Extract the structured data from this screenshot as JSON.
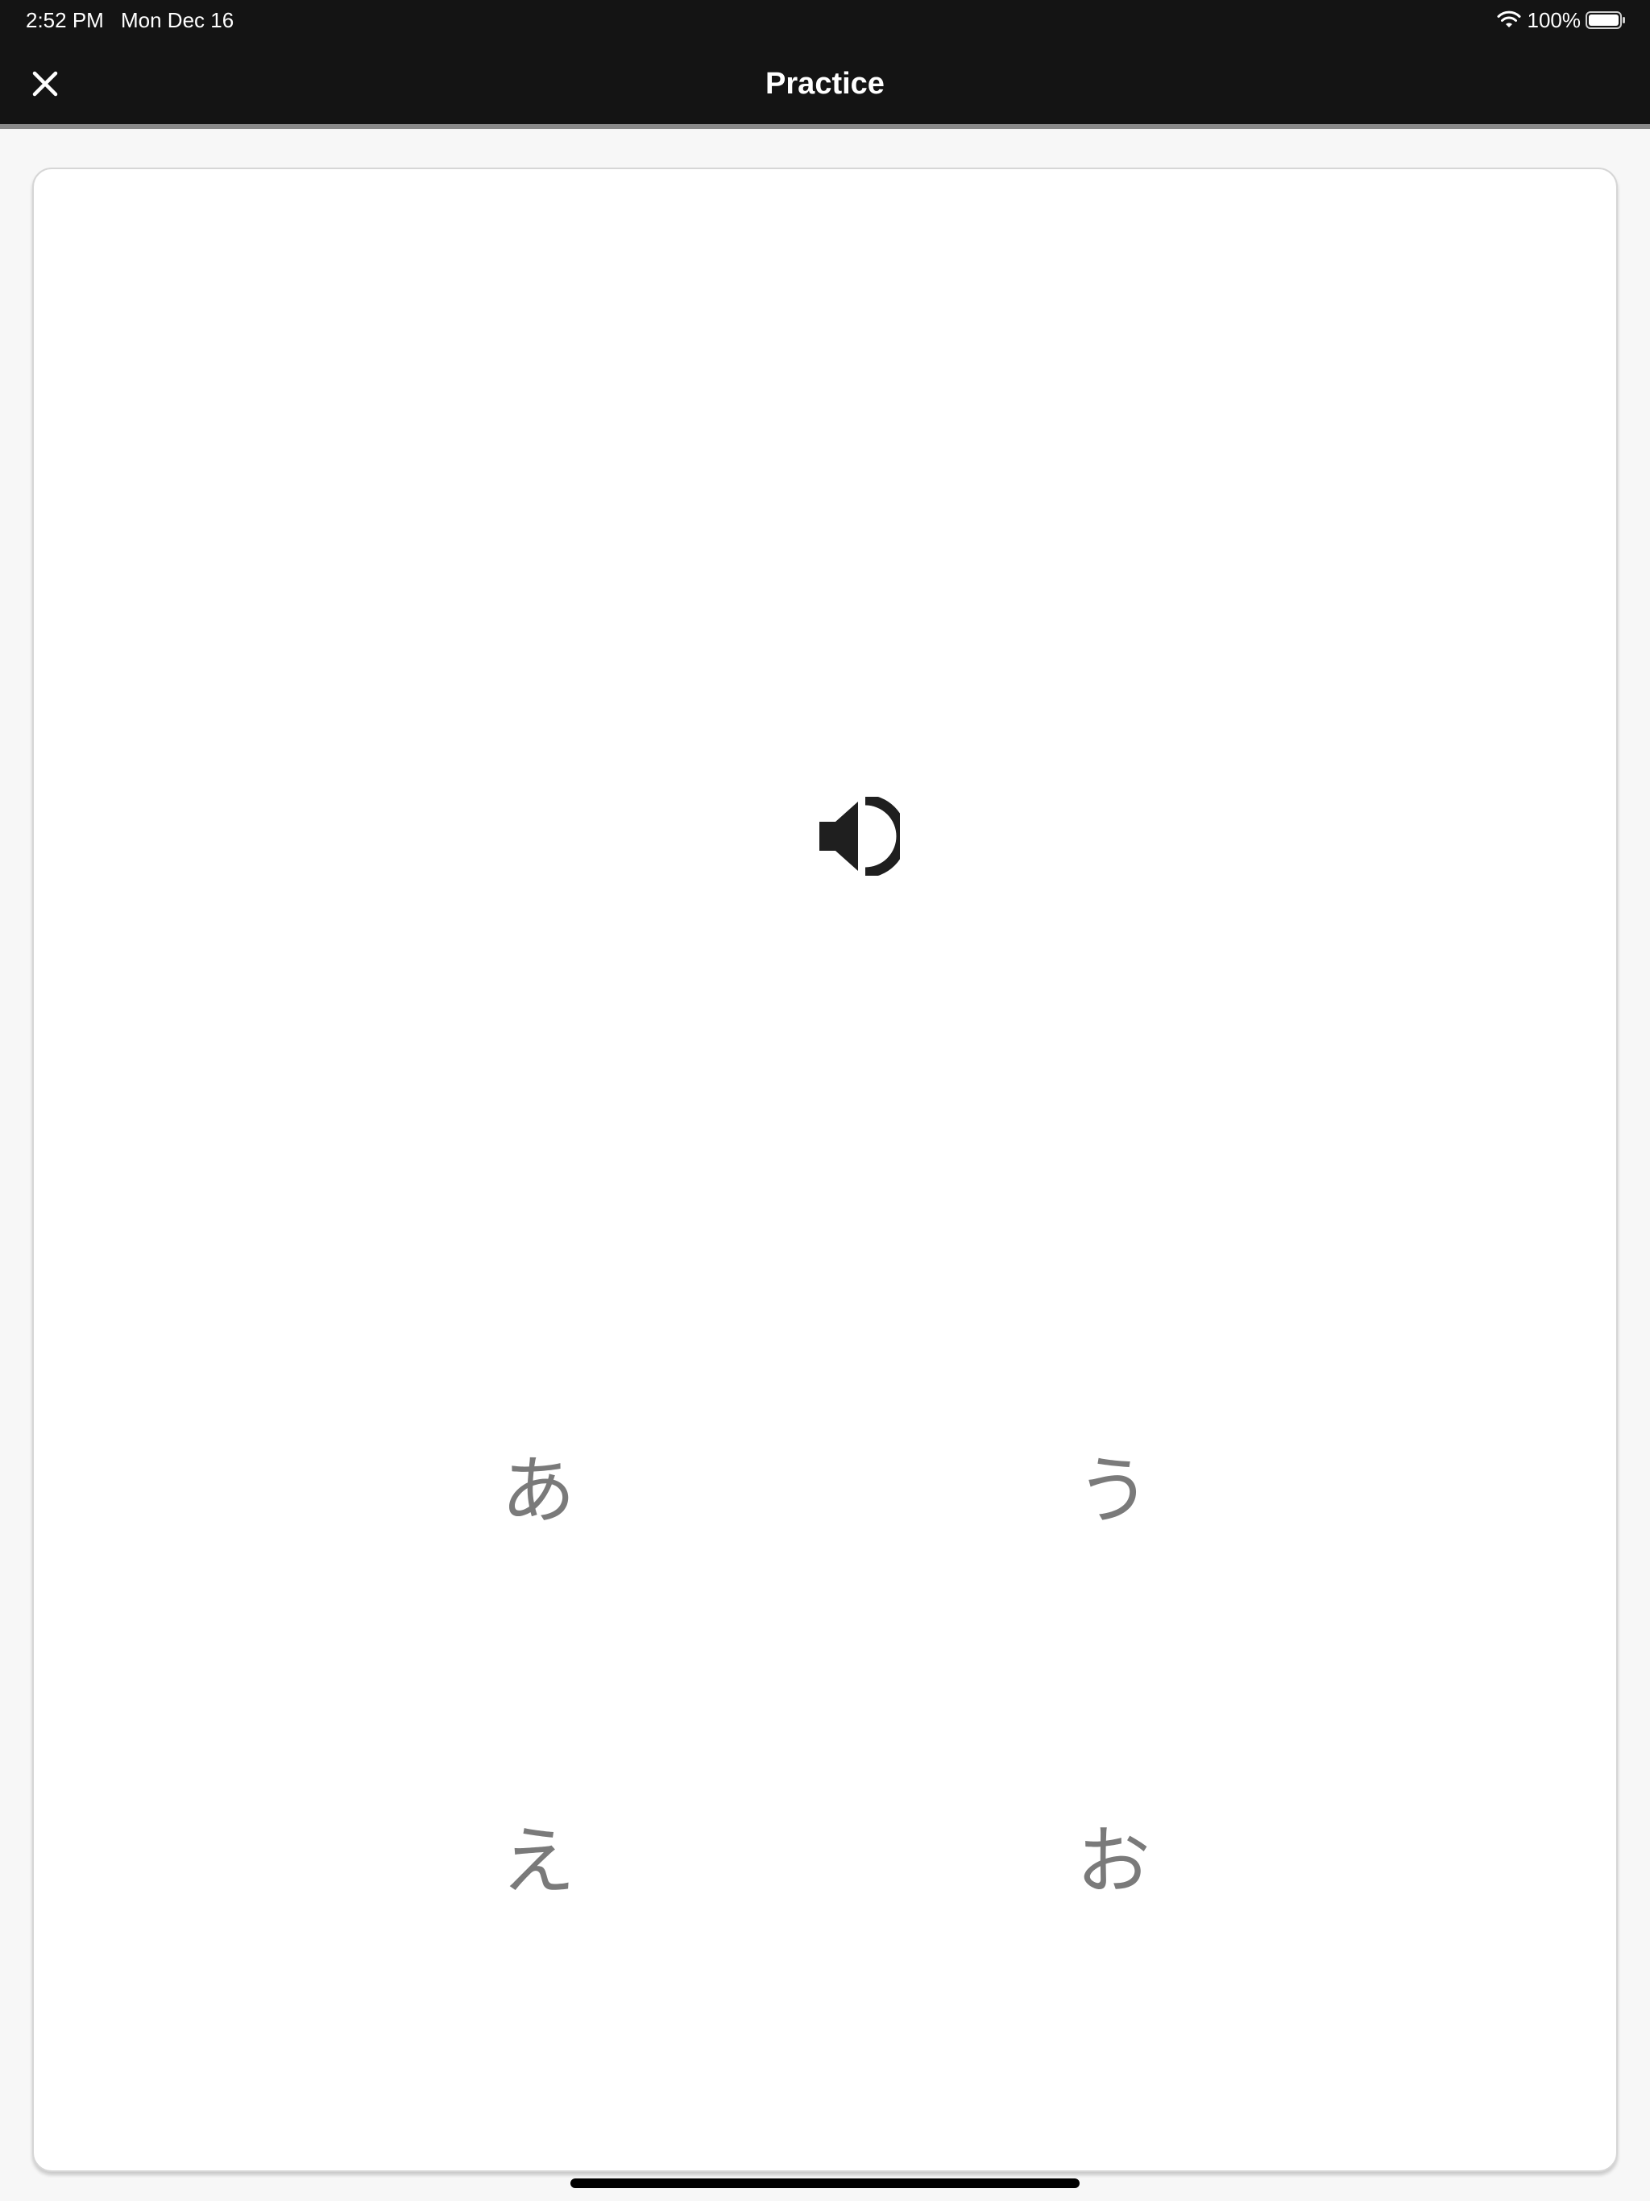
{
  "status_bar": {
    "time": "2:52 PM",
    "date": "Mon Dec 16",
    "battery": "100%"
  },
  "header": {
    "title": "Practice",
    "close_icon": "close-icon"
  },
  "card": {
    "audio_icon": "speaker-icon",
    "choices": [
      "あ",
      "う",
      "え",
      "お"
    ]
  },
  "colors": {
    "header_bg": "#141414",
    "choice_text": "#7a7a7a",
    "page_bg": "#f7f7f7"
  }
}
